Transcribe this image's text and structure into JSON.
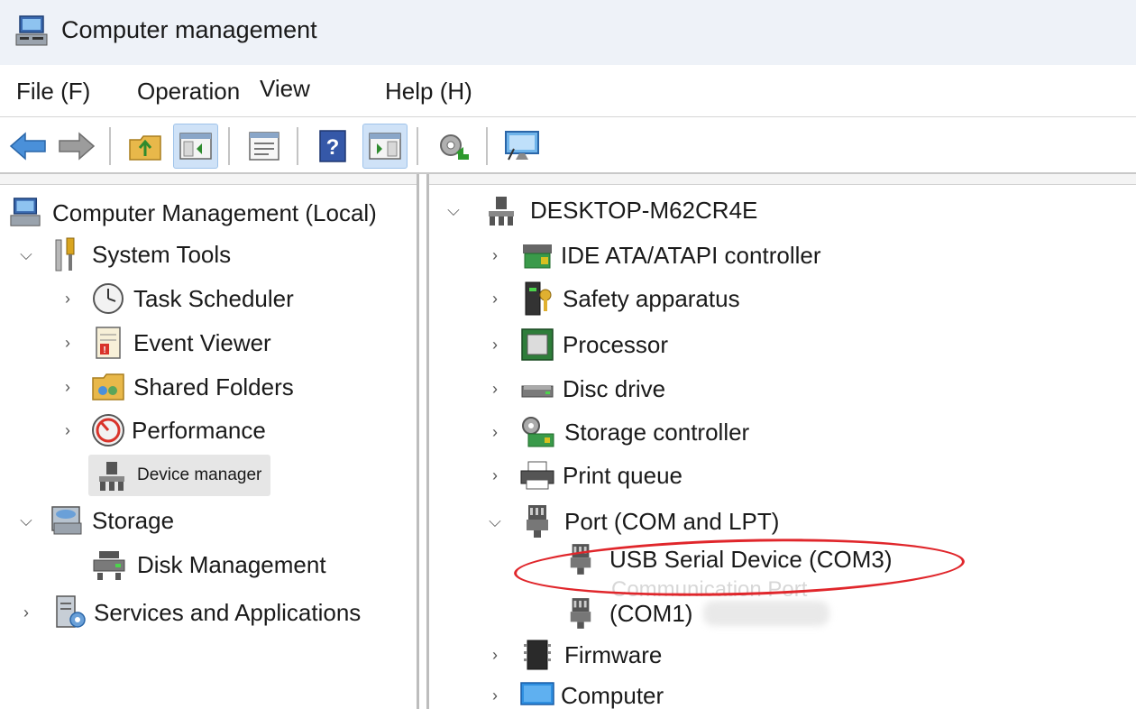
{
  "window": {
    "title": "Computer management"
  },
  "menu": [
    {
      "label": "File (F)"
    },
    {
      "label": "Operation"
    },
    {
      "label": "View"
    },
    {
      "label": "Help (H)"
    }
  ],
  "toolbar": {
    "icons": [
      "back-arrow-icon",
      "forward-arrow-icon",
      "up-folder-icon",
      "show-hide-tree-icon",
      "properties-icon",
      "help-icon",
      "show-action-pane-icon",
      "scan-hardware-icon",
      "monitor-icon"
    ]
  },
  "left_tree": {
    "root": "Computer Management (Local)",
    "system_tools": "System Tools",
    "task_scheduler": "Task Scheduler",
    "event_viewer": "Event Viewer",
    "shared_folders": "Shared Folders",
    "performance": "Performance",
    "device_manager": "Device manager",
    "storage": "Storage",
    "disk_management": "Disk Management",
    "services": "Services and Applications"
  },
  "right_tree": {
    "computer_name": "DESKTOP-M62CR4E",
    "categories": [
      {
        "label": "IDE ATA/ATAPI controller"
      },
      {
        "label": "Safety apparatus"
      },
      {
        "label": "Processor"
      },
      {
        "label": "Disc drive"
      },
      {
        "label": "Storage controller"
      },
      {
        "label": "Print queue"
      },
      {
        "label": "Port (COM and LPT)"
      }
    ],
    "ports": [
      {
        "label": "USB Serial Device (COM3)"
      },
      {
        "label": "(COM1)"
      }
    ],
    "faded_label": "Communication Port",
    "after": [
      {
        "label": "Firmware"
      },
      {
        "label": "Computer"
      }
    ]
  },
  "colors": {
    "highlight": "#e0262b",
    "accent": "#2f7fd6",
    "selected_bg": "#e6e6e6"
  }
}
